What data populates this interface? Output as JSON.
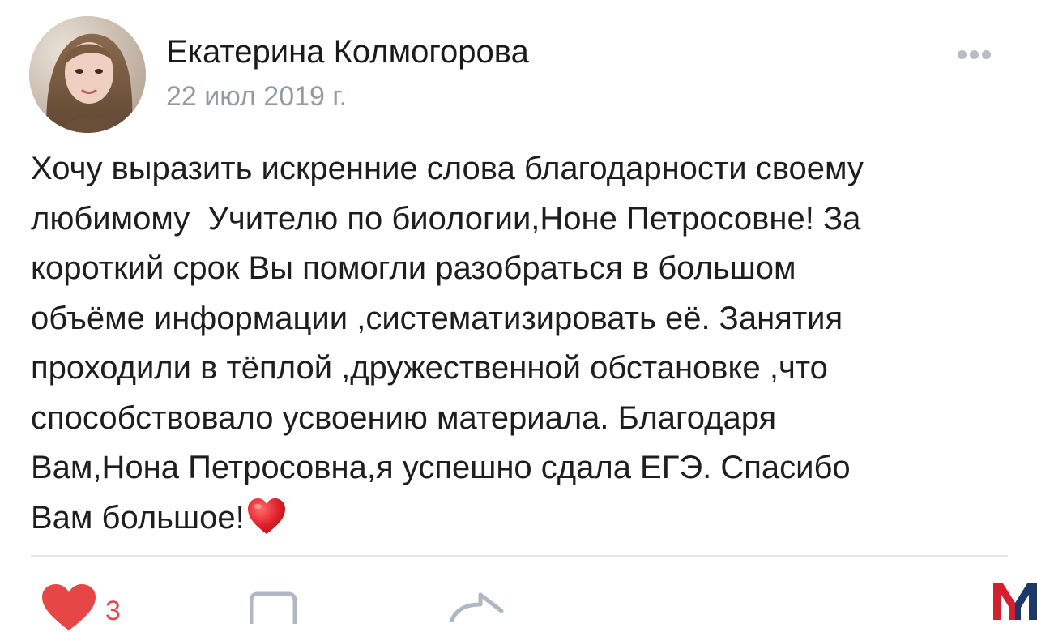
{
  "post": {
    "author_name": "Екатерина Колмогорова",
    "date": "22 июл 2019 г.",
    "text": "Хочу выразить искренние слова благодарности своему\nлюбимому  Учителю по биологии,Ноне Петросовне! За\nкороткий срок Вы помогли разобраться в большом\nобъёме информации ,систематизировать её. Занятия\nпроходили в тёплой ,дружественной обстановке ,что\nспособствовало усвоению материала. Благодаря\nВам,Нона Петросовна,я успешно сдала ЕГЭ. Спасибо\nВам большое!",
    "text_emoji": "red-heart-emoji"
  },
  "actions": {
    "like_count": "3",
    "like_icon": "heart-icon",
    "comment_icon": "comment-icon",
    "share_icon": "share-icon",
    "more_icon": "more-dots-icon"
  },
  "colors": {
    "like_red": "#e64646",
    "secondary_text": "#939aa1",
    "icon_gray": "#aeb7c2",
    "divider": "#e4e6e9",
    "watermark_red": "#d3202f",
    "watermark_navy": "#1c3a67"
  },
  "watermark": {
    "letter": "M"
  }
}
